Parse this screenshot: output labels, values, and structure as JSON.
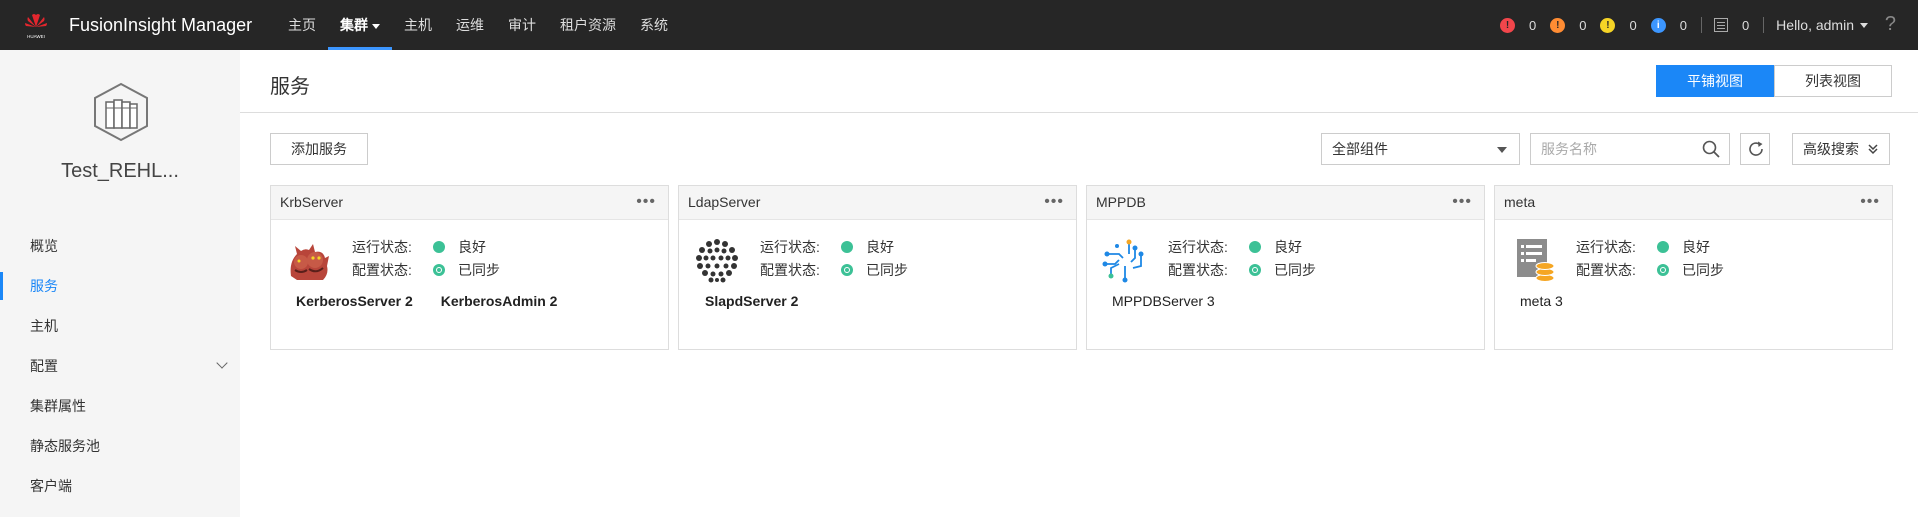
{
  "topbar": {
    "brand_small": "HUAWEI",
    "brand": "FusionInsight Manager",
    "nav": [
      {
        "label": "主页",
        "active": false
      },
      {
        "label": "集群",
        "active": true
      },
      {
        "label": "主机",
        "active": false
      },
      {
        "label": "运维",
        "active": false
      },
      {
        "label": "审计",
        "active": false
      },
      {
        "label": "租户资源",
        "active": false
      },
      {
        "label": "系统",
        "active": false
      }
    ],
    "alarms": [
      {
        "name": "critical-alarm-icon",
        "color": "#f2464b",
        "count": "0"
      },
      {
        "name": "major-alarm-icon",
        "color": "#ff8c33",
        "count": "0"
      },
      {
        "name": "minor-alarm-icon",
        "color": "#f5d426",
        "count": "0"
      },
      {
        "name": "warning-alarm-icon",
        "color": "#3c96ff",
        "count": "0"
      }
    ],
    "task_count": "0",
    "user": "Hello, admin",
    "help": "?"
  },
  "sidebar": {
    "cluster_name": "Test_REHL...",
    "items": [
      {
        "label": "概览"
      },
      {
        "label": "服务"
      },
      {
        "label": "主机"
      },
      {
        "label": "配置"
      },
      {
        "label": "集群属性"
      },
      {
        "label": "静态服务池"
      },
      {
        "label": "客户端"
      }
    ]
  },
  "main": {
    "title": "服务",
    "view_tile": "平铺视图",
    "view_list": "列表视图",
    "add_service": "添加服务",
    "filter_selected": "全部组件",
    "search_placeholder": "服务名称",
    "advanced_search": "高级搜索"
  },
  "labels": {
    "running": "运行状态:",
    "config": "配置状态:"
  },
  "cards": [
    {
      "name": "KrbServer",
      "running": "良好",
      "config": "已同步",
      "roles": [
        "KerberosServer 2",
        "KerberosAdmin 2"
      ]
    },
    {
      "name": "LdapServer",
      "running": "良好",
      "config": "已同步",
      "roles": [
        "SlapdServer 2"
      ]
    },
    {
      "name": "MPPDB",
      "running": "良好",
      "config": "已同步",
      "roles": [
        "MPPDBServer 3"
      ]
    },
    {
      "name": "meta",
      "running": "良好",
      "config": "已同步",
      "roles": [
        "meta 3"
      ]
    }
  ],
  "colors": {
    "accent": "#1b87f7",
    "topbar": "#262626",
    "status_good": "#3cc196"
  }
}
